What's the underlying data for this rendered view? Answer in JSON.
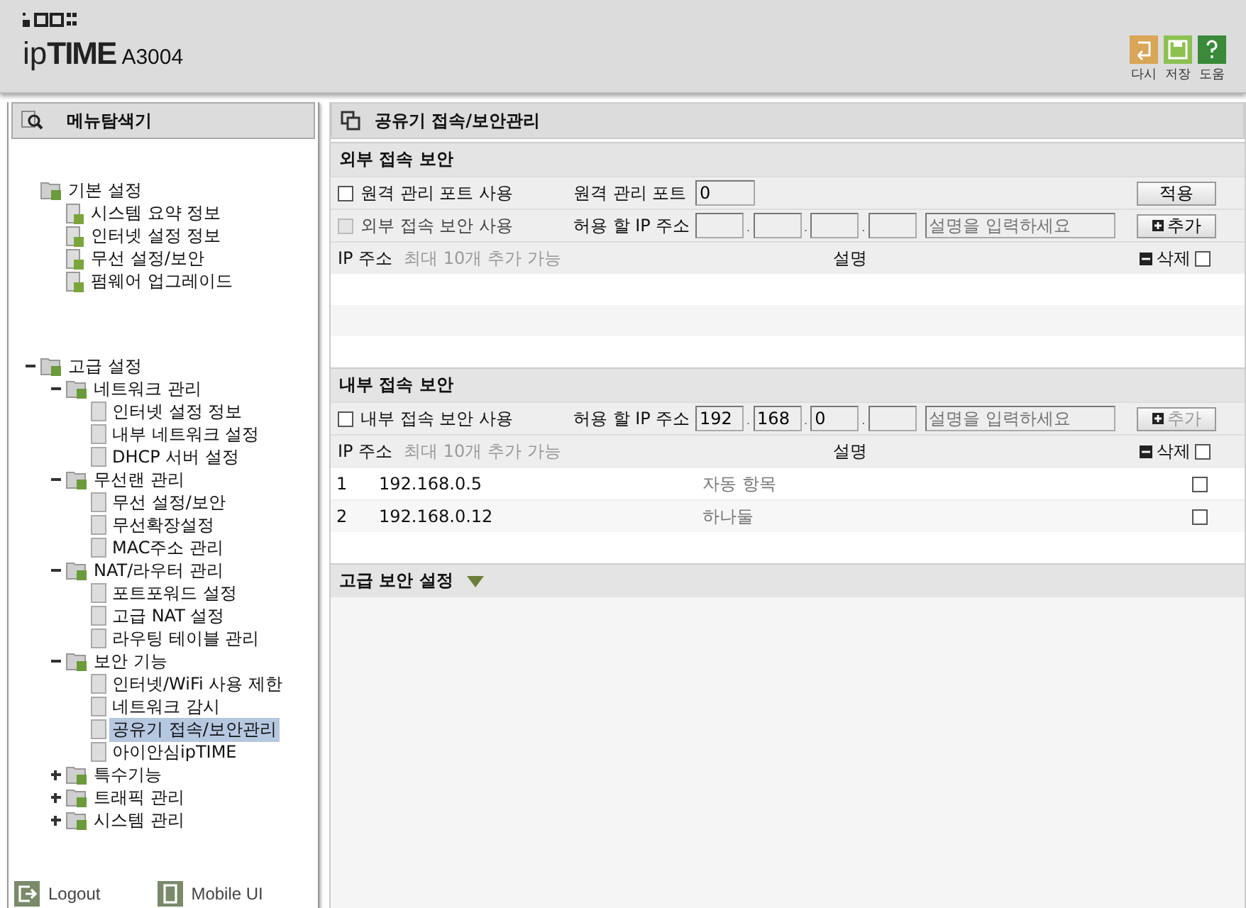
{
  "header": {
    "logo": "ip**TIME**",
    "model": "A3004",
    "actions": [
      {
        "kind": "undo",
        "label": "다시"
      },
      {
        "kind": "save",
        "label": "저장"
      },
      {
        "kind": "help",
        "label": "도움"
      }
    ]
  },
  "sidebar": {
    "title": "메뉴탐색기",
    "tree": [
      {
        "label": "기본 설정",
        "collapsible": false,
        "selected": false,
        "children": [
          {
            "label": "시스템 요약 정보",
            "selected": false
          },
          {
            "label": "인터넷 설정 정보",
            "selected": false
          },
          {
            "label": "무선 설정/보안",
            "selected": false
          },
          {
            "label": "펌웨어 업그레이드",
            "selected": false
          }
        ]
      },
      {
        "label": "고급 설정",
        "collapsible": true,
        "expanded": true,
        "selected": false,
        "children": [
          {
            "label": "네트워크 관리",
            "collapsible": true,
            "expanded": true,
            "selected": false,
            "children": [
              {
                "label": "인터넷 설정 정보",
                "selected": false
              },
              {
                "label": "내부 네트워크 설정",
                "selected": false
              },
              {
                "label": "DHCP 서버 설정",
                "selected": false
              }
            ]
          },
          {
            "label": "무선랜 관리",
            "collapsible": true,
            "expanded": true,
            "selected": false,
            "children": [
              {
                "label": "무선 설정/보안",
                "selected": false
              },
              {
                "label": "무선확장설정",
                "selected": false
              },
              {
                "label": "MAC주소 관리",
                "selected": false
              }
            ]
          },
          {
            "label": "NAT/라우터 관리",
            "collapsible": true,
            "expanded": true,
            "selected": false,
            "children": [
              {
                "label": "포트포워드 설정",
                "selected": false
              },
              {
                "label": "고급 NAT 설정",
                "selected": false
              },
              {
                "label": "라우팅 테이블 관리",
                "selected": false
              }
            ]
          },
          {
            "label": "보안 기능",
            "collapsible": true,
            "expanded": true,
            "selected": false,
            "children": [
              {
                "label": "인터넷/WiFi 사용 제한",
                "selected": false
              },
              {
                "label": "네트워크 감시",
                "selected": false
              },
              {
                "label": "공유기 접속/보안관리",
                "selected": true
              },
              {
                "label": "아이안심ipTIME",
                "selected": false
              }
            ]
          },
          {
            "label": "특수기능",
            "collapsible": true,
            "expanded": false,
            "selected": false
          },
          {
            "label": "트래픽 관리",
            "collapsible": true,
            "expanded": false,
            "selected": false
          },
          {
            "label": "시스템 관리",
            "collapsible": true,
            "expanded": false,
            "selected": false
          }
        ]
      }
    ],
    "footer": [
      {
        "kind": "logout",
        "label": "Logout"
      },
      {
        "kind": "mobile",
        "label": "Mobile UI"
      }
    ]
  },
  "content": {
    "title": "공유기 접속/보안관리",
    "sections": [
      {
        "kind": "table",
        "title": "외부 접속 보안",
        "controls": [
          {
            "kind": "port",
            "checkbox": {
              "label": "원격 관리 포트 사용",
              "checked": false,
              "disabled": false
            },
            "field_label": "원격 관리 포트",
            "value": "0",
            "button": {
              "label": "적용",
              "disabled": false
            }
          },
          {
            "kind": "ip",
            "checkbox": {
              "label": "외부 접속 보안 사용",
              "checked": false,
              "disabled": true
            },
            "field_label": "허용 할 IP 주소",
            "separators": [
              ".",
              ".",
              "."
            ],
            "placeholder": "설명을 입력하세요",
            "button": {
              "label": "추가",
              "disabled": false
            }
          }
        ],
        "columns": {
          "ip": "IP 주소",
          "note": "최대 10개 추가 가능",
          "description": "설명",
          "delete": "삭제",
          "checked": false
        }
      },
      {
        "kind": "table",
        "title": "내부 접속 보안",
        "controls": [
          {
            "kind": "ip",
            "checkbox": {
              "label": "내부 접속 보안 사용",
              "checked": false,
              "disabled": false
            },
            "field_label": "허용 할 IP 주소",
            "octets": [
              "192",
              "168",
              "0"
            ],
            "separators": [
              ".",
              ".",
              "."
            ],
            "placeholder": "설명을 입력하세요",
            "button": {
              "label": "추가",
              "disabled": true
            }
          }
        ],
        "columns": {
          "ip": "IP 주소",
          "note": "최대 10개 추가 가능",
          "description": "설명",
          "delete": "삭제",
          "checked": false
        },
        "rows": [
          {
            "index": "1",
            "ip": "192.168.0.5",
            "description": "자동 항목",
            "checked": false
          },
          {
            "index": "2",
            "ip": "192.168.0.12",
            "description": "하나둘",
            "checked": false
          }
        ]
      },
      {
        "kind": "collapsible",
        "title": "고급 보안 설정",
        "expanded": false
      }
    ]
  }
}
